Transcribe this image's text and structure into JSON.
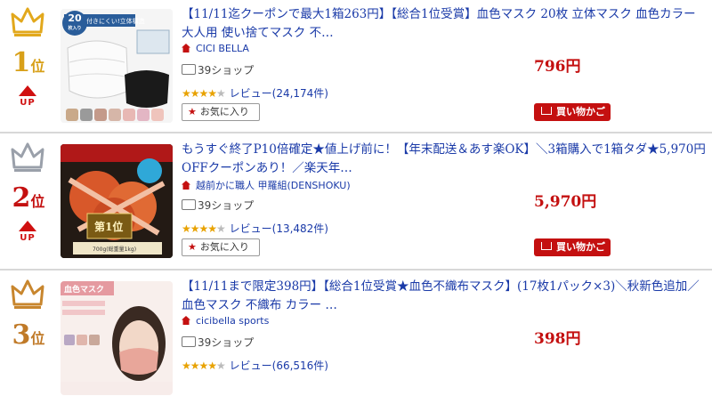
{
  "rank_suffix": "位",
  "up_label": "UP",
  "items": [
    {
      "rank": "1",
      "crown_color": "#e2a81c",
      "rank_color": "#d8a019",
      "title": "【11/11迄クーポンで最大1箱263円】【総合1位受賞】血色マスク 20枚 立体マスク 血色カラー 大人用 使い捨てマスク 不…",
      "shop": "CICI BELLA",
      "coupon": "39ショップ",
      "price": "796円",
      "review_label": "レビュー",
      "review_count": "(24,174件)",
      "rating": 4,
      "fav_label": "お気に入り",
      "cart_label": "買い物かご",
      "badge": "20",
      "badge_unit": "枚入り",
      "thumb_caption": "口紅に付きにくい!立体構造"
    },
    {
      "rank": "2",
      "crown_color": "#9aa0aa",
      "rank_color": "#8a8f98",
      "title": "もうすぐ終了P10倍確定★値上げ前に！【年末配送＆あす楽OK】＼3箱購入で1箱タダ★5,970円OFFクーポンあり！／楽天年…",
      "shop": "越前かに職人 甲羅組(DENSHOKU)",
      "coupon": "39ショップ",
      "price": "5,970円",
      "review_label": "レビュー",
      "review_count": "(13,482件)",
      "rating": 4,
      "fav_label": "お気に入り",
      "cart_label": "買い物かご",
      "badge": "第1位",
      "thumb_caption": "700g(総重量1kg)"
    },
    {
      "rank": "3",
      "crown_color": "#c8862e",
      "rank_color": "#c07a28",
      "title": "【11/11まで限定398円】【総合1位受賞★血色不織布マスク】(17枚1パック×3)＼秋新色追加／血色マスク 不織布 カラー …",
      "shop": "cicibella sports",
      "coupon": "39ショップ",
      "price": "398円",
      "review_label": "レビュー",
      "review_count": "(66,516件)",
      "rating": 4,
      "thumb_caption": "血色マスク"
    }
  ]
}
